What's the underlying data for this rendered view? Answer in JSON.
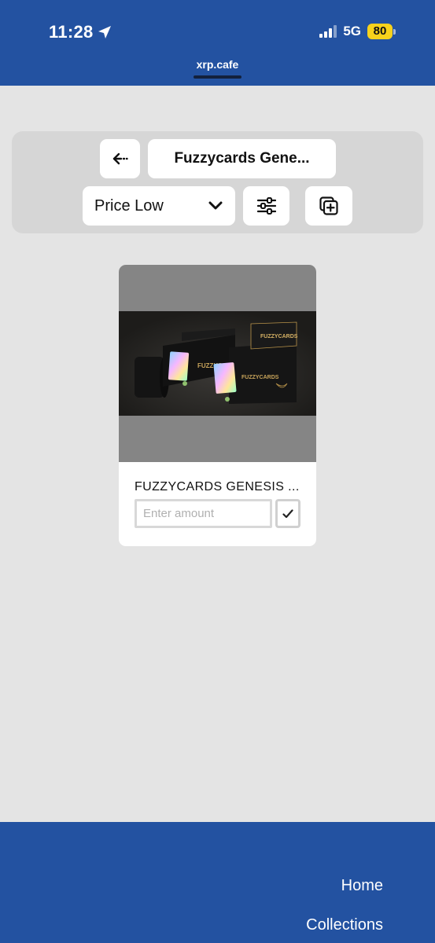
{
  "status_bar": {
    "time": "11:28",
    "network": "5G",
    "battery": "80",
    "location_icon": "location-arrow-icon",
    "signal_icon": "cellular-signal-icon"
  },
  "browser": {
    "url": "xrp.cafe"
  },
  "toolbar": {
    "back_icon": "back-arrow-icon",
    "collection_title": "Fuzzycards Gene...",
    "sort": {
      "selected": "Price Low",
      "icon": "chevron-down-icon"
    },
    "filter_icon": "sliders-icon",
    "add_icon": "add-to-collection-icon"
  },
  "card": {
    "title": "FUZZYCARDS GENESIS ...",
    "amount_placeholder": "Enter amount",
    "confirm_icon": "checkmark-icon"
  },
  "footer": {
    "links": [
      "Home",
      "Collections"
    ]
  },
  "colors": {
    "brand_blue": "#2352a1",
    "page_bg": "#e4e4e4",
    "battery_yellow": "#f7d21c"
  }
}
